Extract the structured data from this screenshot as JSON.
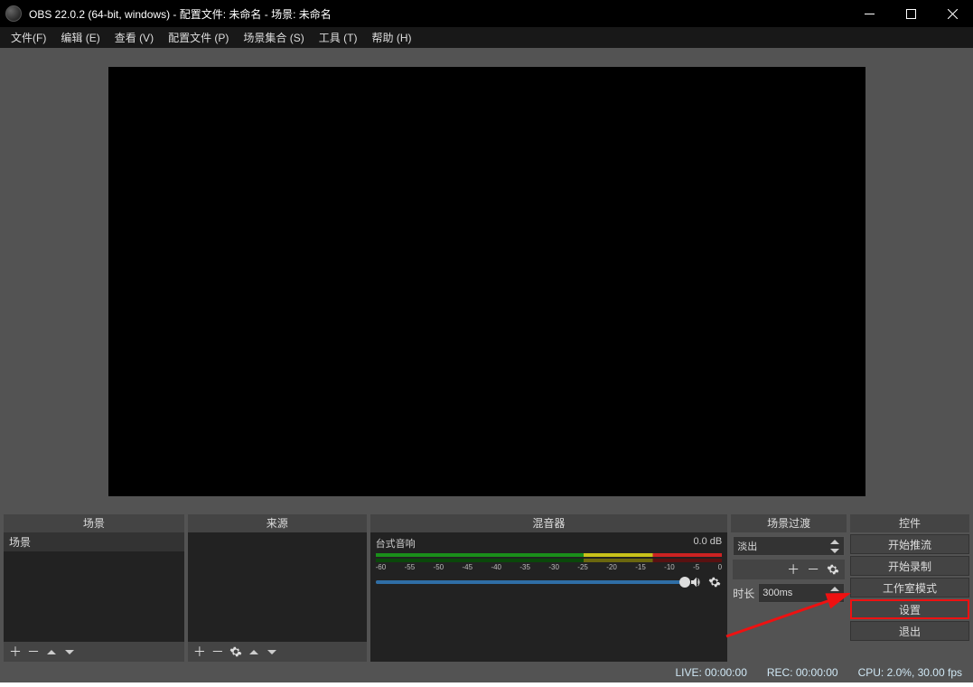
{
  "window": {
    "title": "OBS 22.0.2 (64-bit, windows) - 配置文件: 未命名 - 场景: 未命名"
  },
  "menu": {
    "file": {
      "label": "文件",
      "accel": "(F)"
    },
    "edit": {
      "label": "编辑",
      "accel": "(E)"
    },
    "view": {
      "label": "查看",
      "accel": "(V)"
    },
    "profile": {
      "label": "配置文件",
      "accel": "(P)"
    },
    "scenes": {
      "label": "场景集合",
      "accel": "(S)"
    },
    "tools": {
      "label": "工具",
      "accel": "(T)"
    },
    "help": {
      "label": "帮助",
      "accel": "(H)"
    }
  },
  "docks": {
    "scenes": {
      "title": "场景",
      "items": [
        "场景"
      ]
    },
    "sources": {
      "title": "来源"
    },
    "mixer": {
      "title": "混音器",
      "channel": "台式音响",
      "db": "0.0 dB",
      "ticks": [
        "-60",
        "-55",
        "-50",
        "-45",
        "-40",
        "-35",
        "-30",
        "-25",
        "-20",
        "-15",
        "-10",
        "-5",
        "0"
      ]
    },
    "trans": {
      "title": "场景过渡",
      "type": "淡出",
      "dur_label": "时长",
      "dur_value": "300ms"
    },
    "controls": {
      "title": "控件",
      "buttons": [
        "开始推流",
        "开始录制",
        "工作室模式",
        "设置",
        "退出"
      ],
      "highlight_index": 3
    }
  },
  "status": {
    "live": "LIVE: 00:00:00",
    "rec": "REC: 00:00:00",
    "cpu": "CPU: 2.0%, 30.00 fps"
  }
}
